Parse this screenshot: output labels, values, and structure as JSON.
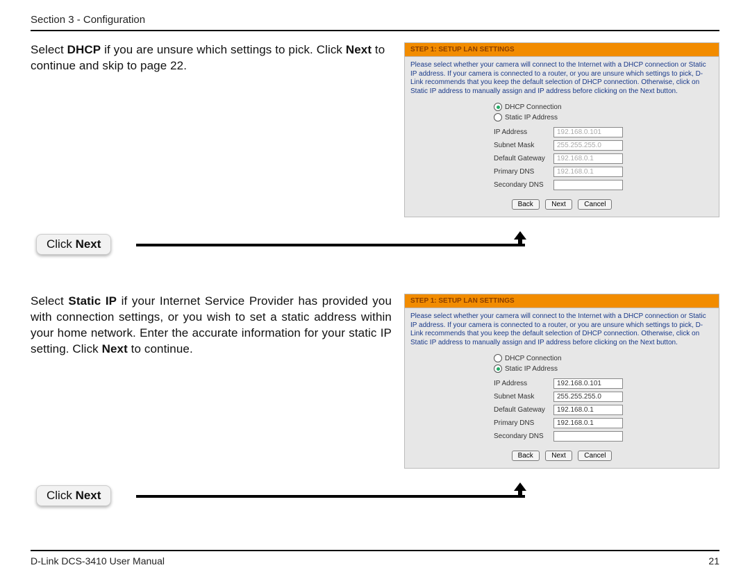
{
  "header": {
    "section": "Section 3 - Configuration"
  },
  "intro1": {
    "pre": "Select ",
    "bold1": "DHCP",
    "mid": " if you are unsure which settings to pick. Click ",
    "bold2": "Next",
    "post": " to continue and skip to page 22."
  },
  "intro2": {
    "pre": "Select ",
    "bold1": "Static IP",
    "mid": " if your Internet Service Provider has provided you with connection settings, or you wish to set a static address within your home network. Enter the accurate information for your static IP setting. Click ",
    "bold2": "Next",
    "post": " to continue."
  },
  "wizard": {
    "title": "STEP 1: SETUP LAN SETTINGS",
    "desc": "Please select whether your camera will connect to the Internet with a DHCP connection or Static IP address. If your camera is connected to a router, or you are unsure which settings to pick, D-Link recommends that you keep the default selection of DHCP connection. Otherwise, click on Static IP address to manually assign and IP address before clicking on the Next button.",
    "radio_dhcp": "DHCP Connection",
    "radio_static": "Static IP Address",
    "labels": {
      "ip": "IP Address",
      "subnet": "Subnet Mask",
      "gateway": "Default Gateway",
      "pdns": "Primary DNS",
      "sdns": "Secondary DNS"
    },
    "values": {
      "ip": "192.168.0.101",
      "subnet": "255.255.255.0",
      "gateway": "192.168.0.1",
      "pdns": "192.168.0.1",
      "sdns": ""
    },
    "buttons": {
      "back": "Back",
      "next": "Next",
      "cancel": "Cancel"
    }
  },
  "callout": {
    "pre": "Click ",
    "bold": "Next"
  },
  "footer": {
    "manual": "D-Link DCS-3410 User Manual",
    "page": "21"
  }
}
